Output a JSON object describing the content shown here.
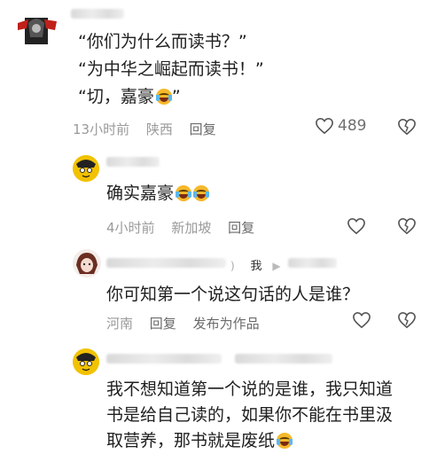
{
  "top_comment": {
    "lines": [
      "“你们为什么而读书？”",
      "“为中华之崛起而读书！”",
      "“切，嘉豪"
    ],
    "line3_suffix": "”",
    "time": "13小时前",
    "location": "陕西",
    "reply_label": "回复",
    "like_count": "489"
  },
  "reply1": {
    "text": "确实嘉豪",
    "time": "4小时前",
    "location": "新加坡",
    "reply_label": "回复"
  },
  "reply2": {
    "reply_to_marker": "我",
    "text": "你可知第一个说这句话的人是谁？",
    "location": "河南",
    "reply_label": "回复",
    "publish_label": "发布为作品"
  },
  "reply3": {
    "lines": [
      "我不想知道第一个说的是谁，我只知道",
      "书是给自己读的，如果你不能在书里汲",
      "取营养，那书就是废纸"
    ]
  },
  "icons": {
    "heart": "heart-outline-icon",
    "dislike": "broken-heart-icon",
    "emoji": "laugh-cry-emoji-icon"
  },
  "colors": {
    "text": "#202020",
    "meta": "#9a9a9a",
    "avatar_top": "#1a1a1a",
    "avatar_reply": "#f2c200"
  }
}
